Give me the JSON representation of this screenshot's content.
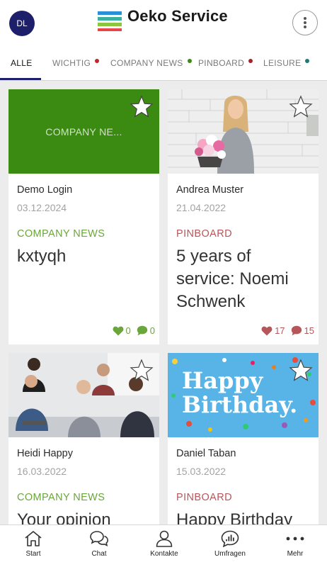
{
  "header": {
    "avatar_initials": "DL",
    "brand": "Oeko Service"
  },
  "tabs": [
    {
      "label": "ALLE",
      "active": true,
      "dot_color": ""
    },
    {
      "label": "WICHTIG",
      "active": false,
      "dot_color": "#c0272d"
    },
    {
      "label": "COMPANY NEWS",
      "active": false,
      "dot_color": "#3b8a12"
    },
    {
      "label": "PINBOARD",
      "active": false,
      "dot_color": "#a3232e"
    },
    {
      "label": "LEISURE",
      "active": false,
      "dot_color": "#1e7b73"
    }
  ],
  "colors": {
    "company_news": "#6aa63b",
    "pinboard": "#b5565b",
    "green_block": "#3b8a12",
    "accent": "#1d1f6b"
  },
  "cards": [
    {
      "media_text": "COMPANY NE...",
      "author": "Demo Login",
      "date": "03.12.2024",
      "category": "COMPANY NEWS",
      "title": "kxtyqh",
      "likes": "0",
      "comments": "0"
    },
    {
      "media_text": "",
      "author": "Andrea Muster",
      "date": "21.04.2022",
      "category": "PINBOARD",
      "title": "5 years of service: Noemi Schwenk",
      "likes": "17",
      "comments": "15"
    },
    {
      "media_text": "",
      "author": "Heidi Happy",
      "date": "16.03.2022",
      "category": "COMPANY NEWS",
      "title": "Your opinion"
    },
    {
      "media_text": "Happy Birthday.",
      "author": "Daniel Taban",
      "date": "15.03.2022",
      "category": "PINBOARD",
      "title": "Happy Birthday"
    }
  ],
  "bottom_nav": [
    {
      "label": "Start",
      "icon": "home-icon"
    },
    {
      "label": "Chat",
      "icon": "chat-icon"
    },
    {
      "label": "Kontakte",
      "icon": "person-icon"
    },
    {
      "label": "Umfragen",
      "icon": "poll-icon"
    },
    {
      "label": "Mehr",
      "icon": "more-icon"
    }
  ]
}
